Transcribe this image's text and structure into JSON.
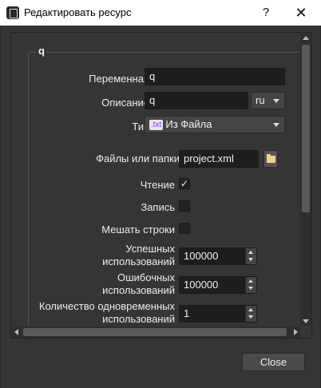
{
  "window": {
    "title": "Редактировать ресурс",
    "help_label": "?",
    "close_label": "✕"
  },
  "group": {
    "title": "q"
  },
  "form": {
    "variable": {
      "label": "Переменная",
      "value": "q"
    },
    "description": {
      "label": "Описание",
      "value": "q",
      "language": "ru"
    },
    "type": {
      "label": "Тип",
      "badge": ".txt",
      "value": "Из Файла"
    },
    "files": {
      "label": "Файлы или папки",
      "value": "project.xml"
    },
    "read": {
      "label": "Чтение",
      "checked": true,
      "mark": "✓"
    },
    "write": {
      "label": "Запись",
      "checked": false
    },
    "shuffle": {
      "label": "Мешать строки",
      "checked": false
    },
    "success_uses": {
      "label_line1": "Успешных",
      "label_line2": "использований",
      "value": "100000"
    },
    "error_uses": {
      "label_line1": "Ошибочных",
      "label_line2": "использований",
      "value": "100000"
    },
    "concurrent_uses": {
      "label_line1": "Количество одновременных",
      "label_line2": "использований",
      "value": "1"
    }
  },
  "footer": {
    "close_label": "Close"
  },
  "icons": {
    "app": "app-icon",
    "browse": "folder-icon",
    "help": "help-icon",
    "close": "close-icon"
  }
}
